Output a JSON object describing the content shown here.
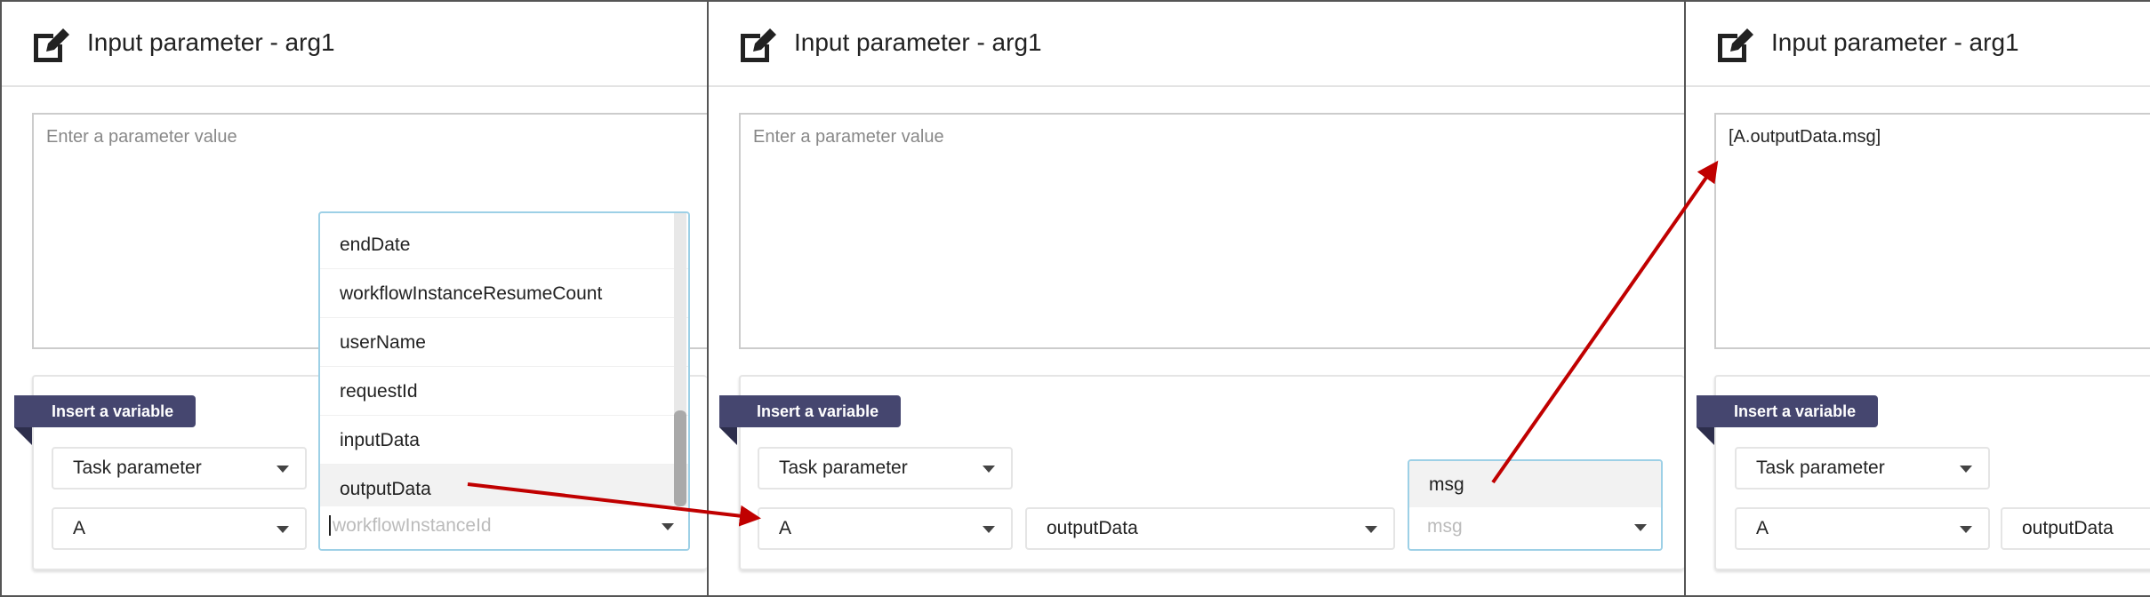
{
  "panels": [
    {
      "title": "Input parameter - arg1",
      "textarea_placeholder": "Enter a parameter value",
      "textarea_value": "",
      "insert_label": "Insert a variable",
      "source_select": "Task parameter",
      "task_select": "A",
      "field_select_placeholder": "workflowInstanceId",
      "dropdown_items": [
        "endDate",
        "workflowInstanceResumeCount",
        "userName",
        "requestId",
        "inputData",
        "outputData"
      ],
      "highlighted_item": "outputData",
      "scroll_fraction": 0.85
    },
    {
      "title": "Input parameter - arg1",
      "textarea_placeholder": "Enter a parameter value",
      "textarea_value": "",
      "insert_label": "Insert a variable",
      "source_select": "Task parameter",
      "task_select": "A",
      "field_select": "outputData",
      "subfield_placeholder": "msg",
      "subfield_option": "msg"
    },
    {
      "title": "Input parameter - arg1",
      "textarea_value": "[A.outputData.msg]",
      "insert_label": "Insert a variable",
      "source_select": "Task parameter",
      "task_select": "A",
      "field_select": "outputData"
    }
  ],
  "icons": {
    "header": "edit-icon",
    "caret": "caret-down-icon"
  },
  "colors": {
    "banner": "#45466f",
    "annotation_arrow": "#c00000",
    "focus_border": "#9dd0e6"
  }
}
